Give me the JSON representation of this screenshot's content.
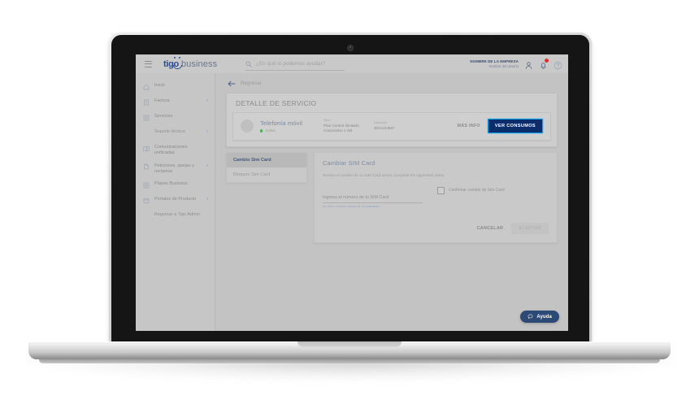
{
  "header": {
    "menu_icon": "hamburger-icon",
    "logo_primary": "tigo",
    "logo_secondary": "business",
    "search_placeholder": "¿En qué lo podemos ayudar?",
    "search_value": "",
    "company": "NOMBRE DE LA EMPRESA",
    "username": "Nombre del usuario",
    "account_icon": "user-icon",
    "notifications_icon": "bell-icon",
    "help_icon": "question-circle-icon",
    "notification_badge": ""
  },
  "sidebar": {
    "items": [
      {
        "label": "Inicio",
        "icon": "home-icon",
        "chevron": false,
        "sub": false
      },
      {
        "label": "Factura",
        "icon": "invoice-icon",
        "chevron": true,
        "sub": false
      },
      {
        "label": "Servicios",
        "icon": "grid-icon",
        "chevron": false,
        "sub": false
      },
      {
        "label": "Soporte técnico",
        "icon": "",
        "chevron": true,
        "sub": true
      },
      {
        "label": "Comunicaciones unificadas",
        "icon": "chat-icon",
        "chevron": false,
        "sub": false
      },
      {
        "label": "Peticiones, quejas y reclamos",
        "icon": "document-icon",
        "chevron": true,
        "sub": false
      },
      {
        "label": "Planes Business",
        "icon": "grid-icon",
        "chevron": false,
        "sub": false
      },
      {
        "label": "Portales de Producto",
        "icon": "window-icon",
        "chevron": true,
        "sub": false
      },
      {
        "label": "Regresar a Tigo Admin",
        "icon": "",
        "chevron": false,
        "sub": true
      }
    ]
  },
  "main": {
    "back_label": "Regresar",
    "back_icon": "arrow-left-icon",
    "card_title": "DETALLE DE SERVICIO",
    "service": {
      "name": "Telefonía móvil",
      "status": "Activo",
      "status_color": "#4caf50",
      "plan_label": "Plan:",
      "plan_value": "Plan Control Ilimitado Corporativo 1 GB",
      "address_label": "Dirección:",
      "address_value": "3001234567",
      "more_info": "MÁS INFO",
      "primary_button": "VER CONSUMOS",
      "primary_button_color": "#0b2d6b",
      "primary_button_focus_color": "#13a0e8"
    },
    "tabs": [
      {
        "label": "Cambio Sim Card",
        "active": true
      },
      {
        "label": "Bloqueo Sim Card",
        "active": false
      }
    ],
    "form": {
      "title": "Cambiar SIM Card",
      "description": "Realice el cambio de su SIM Card actual, complete los siguientes datos",
      "sim_placeholder": "Ingresa el número de tu SIM Card",
      "sim_value": "",
      "hint": "No debe contener menos de 19 caracteres",
      "checkbox_label": "Confirmar cambio de Sim Card",
      "checkbox_checked": false,
      "cancel_label": "CANCELAR",
      "accept_label": "ACEPTAR"
    },
    "help_fab": {
      "label": "Ayuda",
      "icon": "chat-bubble-icon",
      "color": "#2d4a77"
    }
  }
}
